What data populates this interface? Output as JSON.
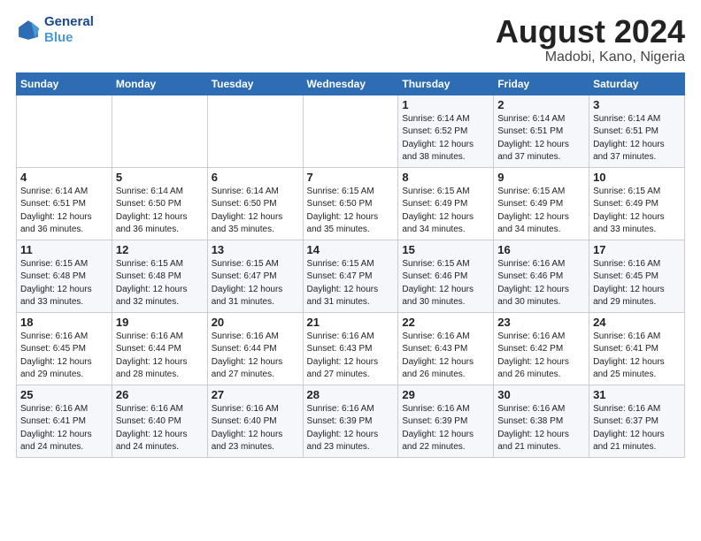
{
  "header": {
    "logo_line1": "General",
    "logo_line2": "Blue",
    "month": "August 2024",
    "location": "Madobi, Kano, Nigeria"
  },
  "weekdays": [
    "Sunday",
    "Monday",
    "Tuesday",
    "Wednesday",
    "Thursday",
    "Friday",
    "Saturday"
  ],
  "weeks": [
    [
      {
        "day": "",
        "text": ""
      },
      {
        "day": "",
        "text": ""
      },
      {
        "day": "",
        "text": ""
      },
      {
        "day": "",
        "text": ""
      },
      {
        "day": "1",
        "text": "Sunrise: 6:14 AM\nSunset: 6:52 PM\nDaylight: 12 hours\nand 38 minutes."
      },
      {
        "day": "2",
        "text": "Sunrise: 6:14 AM\nSunset: 6:51 PM\nDaylight: 12 hours\nand 37 minutes."
      },
      {
        "day": "3",
        "text": "Sunrise: 6:14 AM\nSunset: 6:51 PM\nDaylight: 12 hours\nand 37 minutes."
      }
    ],
    [
      {
        "day": "4",
        "text": "Sunrise: 6:14 AM\nSunset: 6:51 PM\nDaylight: 12 hours\nand 36 minutes."
      },
      {
        "day": "5",
        "text": "Sunrise: 6:14 AM\nSunset: 6:50 PM\nDaylight: 12 hours\nand 36 minutes."
      },
      {
        "day": "6",
        "text": "Sunrise: 6:14 AM\nSunset: 6:50 PM\nDaylight: 12 hours\nand 35 minutes."
      },
      {
        "day": "7",
        "text": "Sunrise: 6:15 AM\nSunset: 6:50 PM\nDaylight: 12 hours\nand 35 minutes."
      },
      {
        "day": "8",
        "text": "Sunrise: 6:15 AM\nSunset: 6:49 PM\nDaylight: 12 hours\nand 34 minutes."
      },
      {
        "day": "9",
        "text": "Sunrise: 6:15 AM\nSunset: 6:49 PM\nDaylight: 12 hours\nand 34 minutes."
      },
      {
        "day": "10",
        "text": "Sunrise: 6:15 AM\nSunset: 6:49 PM\nDaylight: 12 hours\nand 33 minutes."
      }
    ],
    [
      {
        "day": "11",
        "text": "Sunrise: 6:15 AM\nSunset: 6:48 PM\nDaylight: 12 hours\nand 33 minutes."
      },
      {
        "day": "12",
        "text": "Sunrise: 6:15 AM\nSunset: 6:48 PM\nDaylight: 12 hours\nand 32 minutes."
      },
      {
        "day": "13",
        "text": "Sunrise: 6:15 AM\nSunset: 6:47 PM\nDaylight: 12 hours\nand 31 minutes."
      },
      {
        "day": "14",
        "text": "Sunrise: 6:15 AM\nSunset: 6:47 PM\nDaylight: 12 hours\nand 31 minutes."
      },
      {
        "day": "15",
        "text": "Sunrise: 6:15 AM\nSunset: 6:46 PM\nDaylight: 12 hours\nand 30 minutes."
      },
      {
        "day": "16",
        "text": "Sunrise: 6:16 AM\nSunset: 6:46 PM\nDaylight: 12 hours\nand 30 minutes."
      },
      {
        "day": "17",
        "text": "Sunrise: 6:16 AM\nSunset: 6:45 PM\nDaylight: 12 hours\nand 29 minutes."
      }
    ],
    [
      {
        "day": "18",
        "text": "Sunrise: 6:16 AM\nSunset: 6:45 PM\nDaylight: 12 hours\nand 29 minutes."
      },
      {
        "day": "19",
        "text": "Sunrise: 6:16 AM\nSunset: 6:44 PM\nDaylight: 12 hours\nand 28 minutes."
      },
      {
        "day": "20",
        "text": "Sunrise: 6:16 AM\nSunset: 6:44 PM\nDaylight: 12 hours\nand 27 minutes."
      },
      {
        "day": "21",
        "text": "Sunrise: 6:16 AM\nSunset: 6:43 PM\nDaylight: 12 hours\nand 27 minutes."
      },
      {
        "day": "22",
        "text": "Sunrise: 6:16 AM\nSunset: 6:43 PM\nDaylight: 12 hours\nand 26 minutes."
      },
      {
        "day": "23",
        "text": "Sunrise: 6:16 AM\nSunset: 6:42 PM\nDaylight: 12 hours\nand 26 minutes."
      },
      {
        "day": "24",
        "text": "Sunrise: 6:16 AM\nSunset: 6:41 PM\nDaylight: 12 hours\nand 25 minutes."
      }
    ],
    [
      {
        "day": "25",
        "text": "Sunrise: 6:16 AM\nSunset: 6:41 PM\nDaylight: 12 hours\nand 24 minutes."
      },
      {
        "day": "26",
        "text": "Sunrise: 6:16 AM\nSunset: 6:40 PM\nDaylight: 12 hours\nand 24 minutes."
      },
      {
        "day": "27",
        "text": "Sunrise: 6:16 AM\nSunset: 6:40 PM\nDaylight: 12 hours\nand 23 minutes."
      },
      {
        "day": "28",
        "text": "Sunrise: 6:16 AM\nSunset: 6:39 PM\nDaylight: 12 hours\nand 23 minutes."
      },
      {
        "day": "29",
        "text": "Sunrise: 6:16 AM\nSunset: 6:39 PM\nDaylight: 12 hours\nand 22 minutes."
      },
      {
        "day": "30",
        "text": "Sunrise: 6:16 AM\nSunset: 6:38 PM\nDaylight: 12 hours\nand 21 minutes."
      },
      {
        "day": "31",
        "text": "Sunrise: 6:16 AM\nSunset: 6:37 PM\nDaylight: 12 hours\nand 21 minutes."
      }
    ]
  ]
}
